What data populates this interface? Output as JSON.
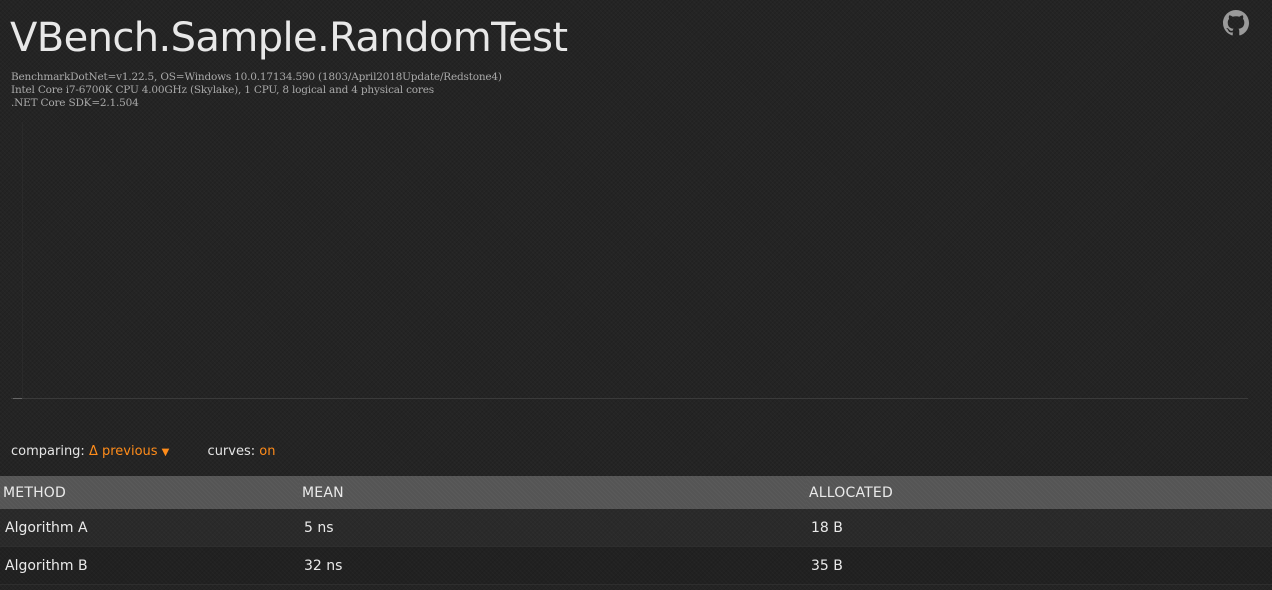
{
  "page": {
    "title": "VBench.Sample.RandomTest",
    "github_icon": "github-icon"
  },
  "sysinfo": {
    "line1": "BenchmarkDotNet=v1.22.5, OS=Windows 10.0.17134.590 (1803/April2018Update/Redstone4)",
    "line2": "Intel Core i7-6700K CPU 4.00GHz (Skylake), 1 CPU, 8 logical and 4 physical cores",
    "line3": ".NET Core SDK=2.1.504"
  },
  "controls": {
    "comparing_label": "comparing:",
    "comparing_value": "Δ previous",
    "comparing_caret": "▼",
    "curves_label": "curves:",
    "curves_value": "on"
  },
  "colors": {
    "accent": "#ff8c1a",
    "background": "#242424",
    "header_bg": "#555555"
  },
  "table": {
    "headers": [
      "METHOD",
      "MEAN",
      "ALLOCATED"
    ],
    "rows": [
      {
        "method": "Algorithm A",
        "mean": "5 ns",
        "allocated": "18 B"
      },
      {
        "method": "Algorithm B",
        "mean": "32 ns",
        "allocated": "35 B"
      }
    ]
  }
}
